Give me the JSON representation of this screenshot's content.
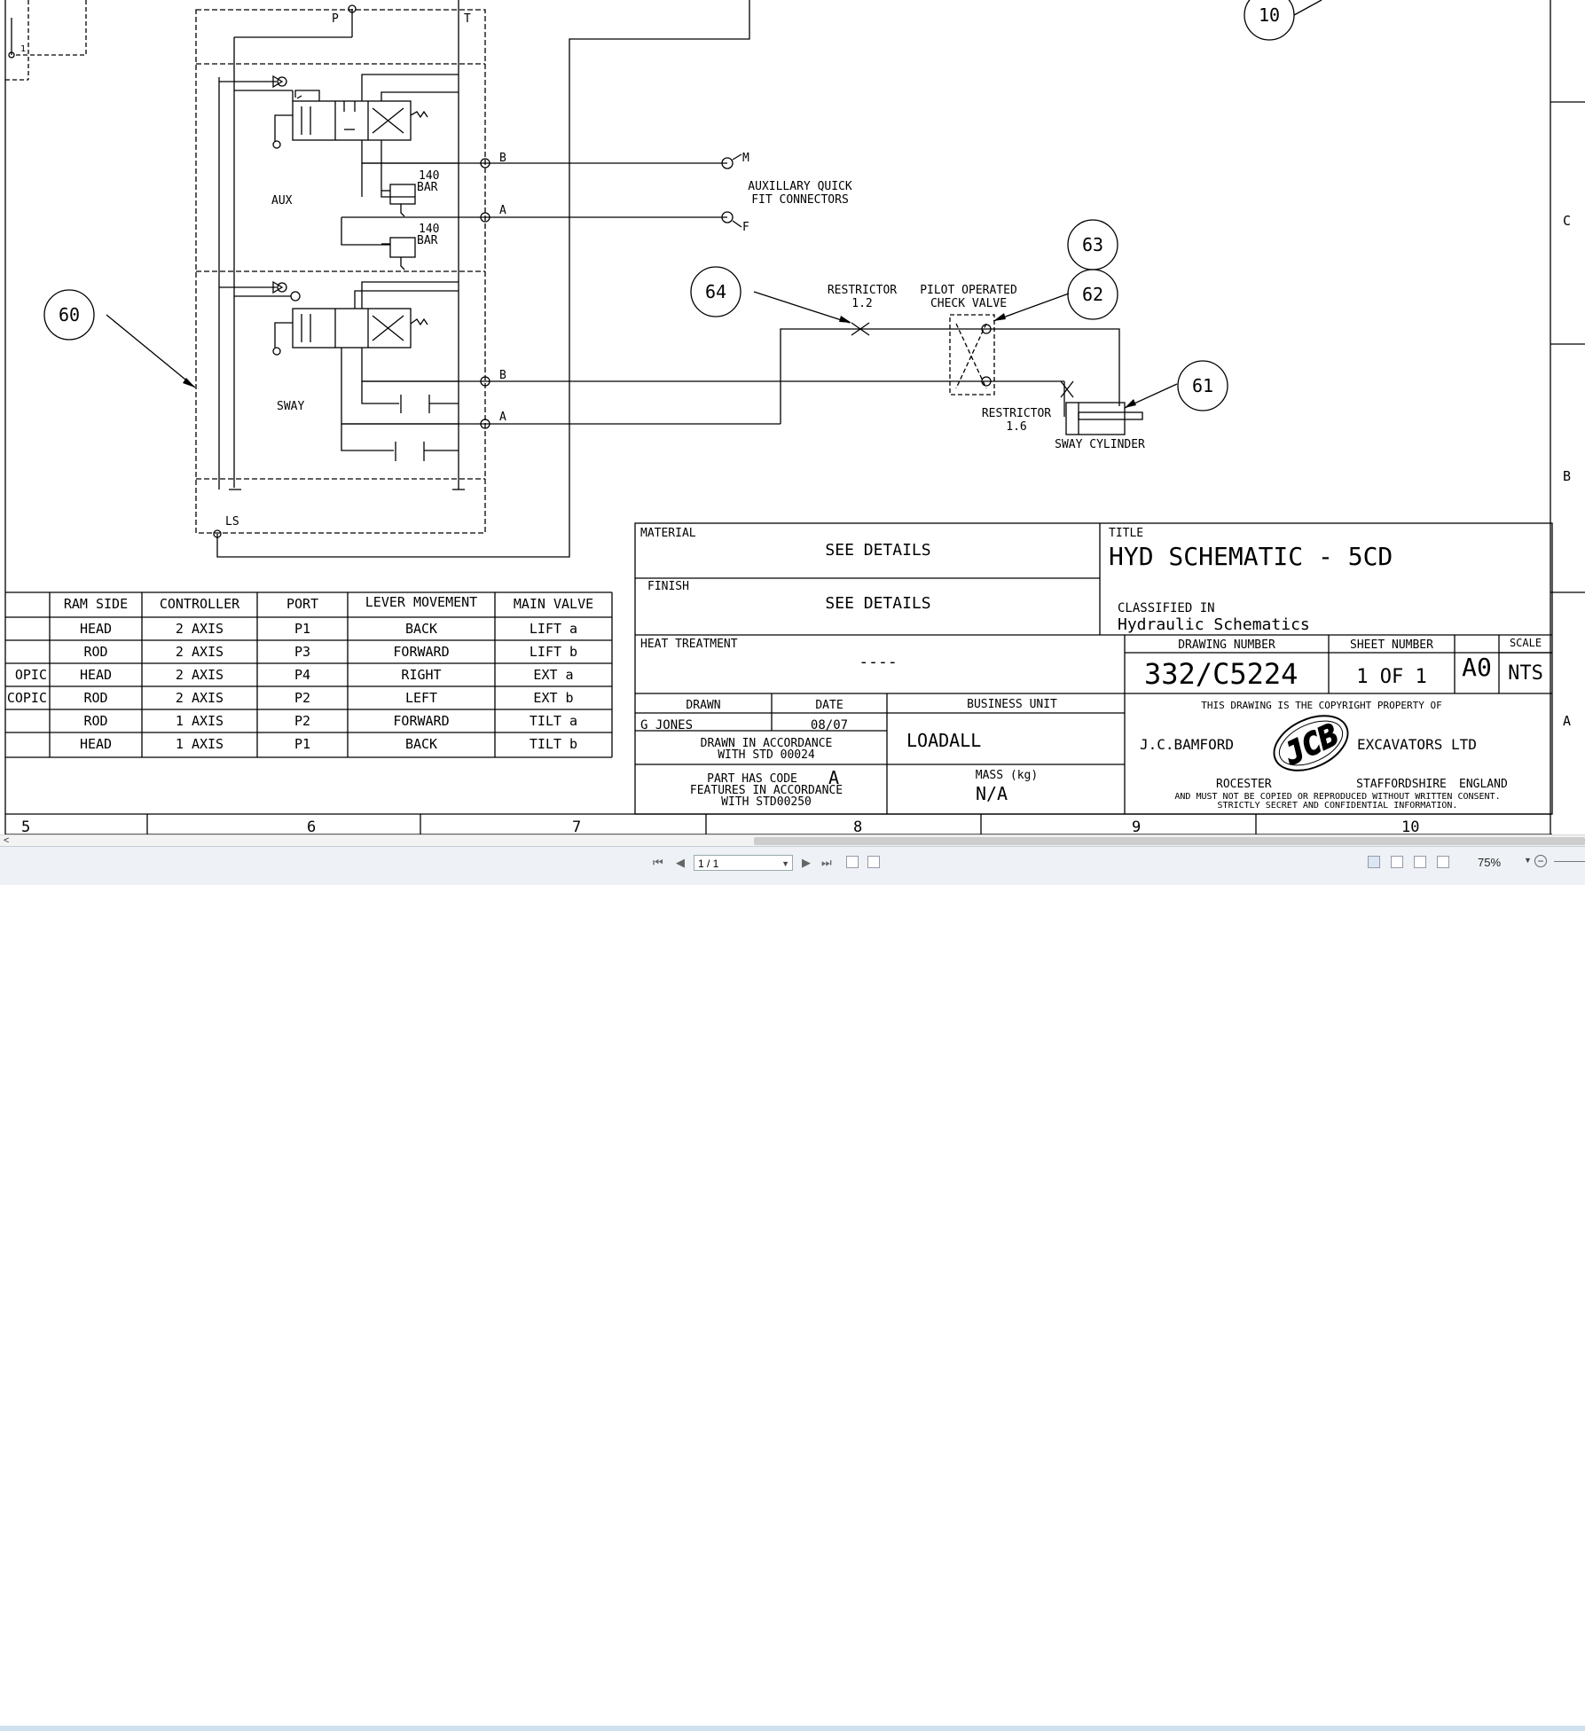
{
  "drawing": {
    "ports": {
      "p": "P",
      "t": "T",
      "b": "B",
      "a": "A",
      "ls": "LS",
      "m": "M",
      "f": "F"
    },
    "labels": {
      "aux": "AUX",
      "sway": "SWAY",
      "relief_value": "140",
      "relief_unit": "BAR",
      "aux_connectors_1": "AUXILLARY QUICK",
      "aux_connectors_2": "FIT CONNECTORS",
      "restrictor": "RESTRICTOR",
      "restrictor_1_value": "1.2",
      "restrictor_2_value": "1.6",
      "pilot_valve_1": "PILOT OPERATED",
      "pilot_valve_2": "CHECK VALVE",
      "sway_cylinder": "SWAY CYLINDER",
      "small_one": "1"
    },
    "balloons": [
      "10",
      "60",
      "63",
      "62",
      "64",
      "61"
    ],
    "zone_rows": [
      "C",
      "B",
      "A"
    ],
    "zone_columns": [
      "5",
      "6",
      "7",
      "8",
      "9",
      "10"
    ]
  },
  "valve_table": {
    "headers": [
      "RAM SIDE",
      "CONTROLLER",
      "PORT",
      "LEVER MOVEMENT",
      "MAIN VALVE"
    ],
    "first_col_fragments": [
      "",
      "",
      "OPIC",
      "COPIC",
      "",
      ""
    ],
    "rows": [
      [
        "HEAD",
        "2 AXIS",
        "P1",
        "BACK",
        "LIFT a"
      ],
      [
        "ROD",
        "2 AXIS",
        "P3",
        "FORWARD",
        "LIFT b"
      ],
      [
        "HEAD",
        "2 AXIS",
        "P4",
        "RIGHT",
        "EXT a"
      ],
      [
        "ROD",
        "2 AXIS",
        "P2",
        "LEFT",
        "EXT b"
      ],
      [
        "ROD",
        "1 AXIS",
        "P2",
        "FORWARD",
        "TILT a"
      ],
      [
        "HEAD",
        "1 AXIS",
        "P1",
        "BACK",
        "TILT b"
      ]
    ]
  },
  "title_block": {
    "material_label": "MATERIAL",
    "material_value": "SEE DETAILS",
    "finish_label": "FINISH",
    "finish_value": "SEE DETAILS",
    "heat_label": "HEAT TREATMENT",
    "heat_value": "----",
    "title_label": "TITLE",
    "title_value": "HYD SCHEMATIC - 5CD",
    "classified_label": "CLASSIFIED IN",
    "classified_value": "Hydraulic Schematics",
    "drawing_number_label": "DRAWING NUMBER",
    "drawing_number": "332/C5224",
    "sheet_number_label": "SHEET NUMBER",
    "sheet_number": "1 OF 1",
    "size": "A0",
    "scale_label": "SCALE",
    "scale": "NTS",
    "drawn_label": "DRAWN",
    "drawn_value": "G JONES",
    "date_label": "DATE",
    "date_value": "08/07",
    "std_1": "DRAWN IN ACCORDANCE",
    "std_2": "WITH STD 00024",
    "code_1": "PART HAS CODE",
    "code_letter": "A",
    "code_2": "FEATURES IN ACCORDANCE",
    "code_3": "WITH STD00250",
    "business_unit_label": "BUSINESS UNIT",
    "business_unit": "LOADALL",
    "mass_label": "MASS (kg)",
    "mass_value": "N/A",
    "copyright_1": "THIS DRAWING IS THE COPYRIGHT PROPERTY OF",
    "company_left": "J.C.BAMFORD",
    "company_right": "EXCAVATORS LTD",
    "logo_text": "JCB",
    "addr_1": "ROCESTER",
    "addr_2": "STAFFORDSHIRE",
    "addr_3": "ENGLAND",
    "legal_1": "AND MUST NOT BE COPIED OR REPRODUCED WITHOUT WRITTEN CONSENT.",
    "legal_2": "STRICTLY SECRET AND CONFIDENTIAL INFORMATION."
  },
  "viewer": {
    "page_value": "1 / 1",
    "zoom": "75%",
    "scroll_left_arrow": "<"
  }
}
